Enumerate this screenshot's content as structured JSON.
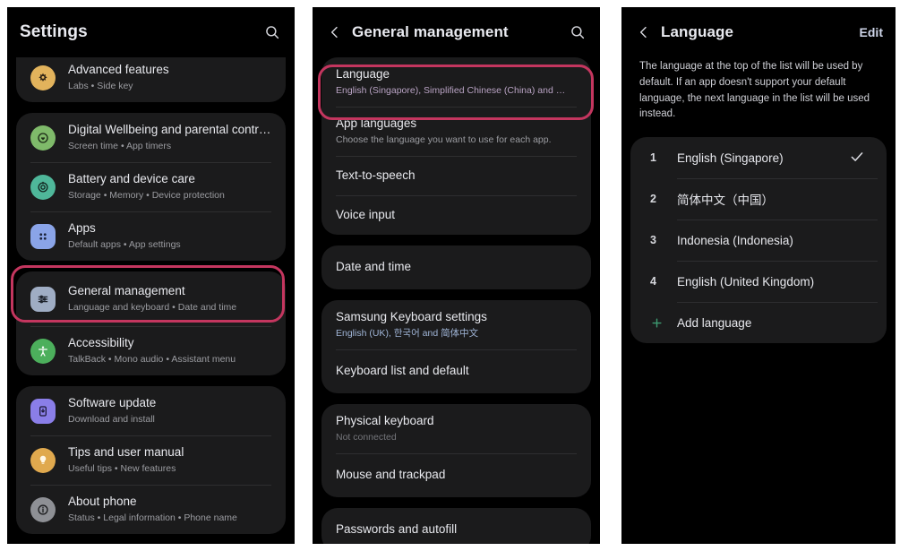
{
  "panels": {
    "settings": {
      "header": {
        "title": "Settings",
        "search_icon": "search-icon"
      },
      "groups": [
        {
          "items": [
            {
              "title": "Advanced features",
              "sub": "Labs  •  Side key",
              "icon": "advanced-features-icon",
              "icon_bg": "#e2b35c",
              "icon_fg": "#2a2013"
            }
          ]
        },
        {
          "items": [
            {
              "title": "Digital Wellbeing and parental controls",
              "sub": "Screen time  •  App timers",
              "icon": "digital-wellbeing-icon",
              "icon_bg": "#7fba6a",
              "icon_fg": "#1c2a16"
            },
            {
              "title": "Battery and device care",
              "sub": "Storage  •  Memory  •  Device protection",
              "icon": "battery-device-care-icon",
              "icon_bg": "#4fb79a",
              "icon_fg": "#132621"
            },
            {
              "title": "Apps",
              "sub": "Default apps  •  App settings",
              "icon": "apps-grid-icon",
              "icon_bg": "#8aa4e8",
              "icon_fg": "#1b2238"
            }
          ]
        },
        {
          "items": [
            {
              "title": "General management",
              "sub": "Language and keyboard  •  Date and time",
              "icon": "sliders-icon",
              "icon_bg": "#9fadc4",
              "icon_fg": "#1d222b"
            },
            {
              "title": "Accessibility",
              "sub": "TalkBack  •  Mono audio  •  Assistant menu",
              "icon": "accessibility-icon",
              "icon_bg": "#4caf5c",
              "icon_fg": "#132b17"
            }
          ]
        },
        {
          "items": [
            {
              "title": "Software update",
              "sub": "Download and install",
              "icon": "software-update-icon",
              "icon_bg": "#8a7ee8",
              "icon_fg": "#1c1936"
            },
            {
              "title": "Tips and user manual",
              "sub": "Useful tips  •  New features",
              "icon": "lightbulb-icon",
              "icon_bg": "#e0a94e",
              "icon_fg": "#2a2011"
            },
            {
              "title": "About phone",
              "sub": "Status  •  Legal information  •  Phone name",
              "icon": "info-icon",
              "icon_bg": "#8e9095",
              "icon_fg": "#1d1e20"
            }
          ]
        }
      ],
      "highlight": {
        "label": "general-management-highlight"
      }
    },
    "general_management": {
      "header": {
        "title": "General management",
        "back_icon": "back-chevron-icon",
        "search_icon": "search-icon"
      },
      "groups": [
        {
          "items": [
            {
              "title": "Language",
              "sub": "English (Singapore), Simplified Chinese (China) and …",
              "sub_style": "lav"
            },
            {
              "title": "App languages",
              "sub": "Choose the language you want to use for each app.",
              "sub_style": ""
            },
            {
              "title": "Text-to-speech",
              "sub": "",
              "sub_style": ""
            },
            {
              "title": "Voice input",
              "sub": "",
              "sub_style": ""
            }
          ]
        },
        {
          "items": [
            {
              "title": "Date and time",
              "sub": "",
              "sub_style": ""
            }
          ]
        },
        {
          "items": [
            {
              "title": "Samsung Keyboard settings",
              "sub": "English (UK), 한국어 and 简体中文",
              "sub_style": "blu"
            },
            {
              "title": "Keyboard list and default",
              "sub": "",
              "sub_style": ""
            }
          ]
        },
        {
          "items": [
            {
              "title": "Physical keyboard",
              "sub": "Not connected",
              "sub_style": "dim"
            },
            {
              "title": "Mouse and trackpad",
              "sub": "",
              "sub_style": ""
            }
          ]
        },
        {
          "items": [
            {
              "title": "Passwords and autofill",
              "sub": "",
              "sub_style": ""
            }
          ]
        }
      ],
      "highlight": {
        "label": "language-row-highlight"
      }
    },
    "language": {
      "header": {
        "title": "Language",
        "back_icon": "back-chevron-icon",
        "edit_label": "Edit"
      },
      "description": "The language at the top of the list will be used by default. If an app doesn't support your default language, the next language in the list will be used instead.",
      "items": [
        {
          "num": "1",
          "label": "English (Singapore)",
          "checked": true
        },
        {
          "num": "2",
          "label": "简体中文（中国）",
          "checked": false
        },
        {
          "num": "3",
          "label": "Indonesia (Indonesia)",
          "checked": false
        },
        {
          "num": "4",
          "label": "English (United Kingdom)",
          "checked": false
        }
      ],
      "add_language": {
        "label": "Add language",
        "icon": "plus-icon",
        "color": "#3e9c72"
      }
    }
  },
  "colors": {
    "highlight": "#c4365f",
    "page_bg": "#000000",
    "card_bg": "#1b1b1c",
    "divider": "#2e2e30",
    "title_text": "#e8e9ee",
    "sub_text": "#9b9ca1",
    "accent_edit": "#cfd6ea"
  }
}
